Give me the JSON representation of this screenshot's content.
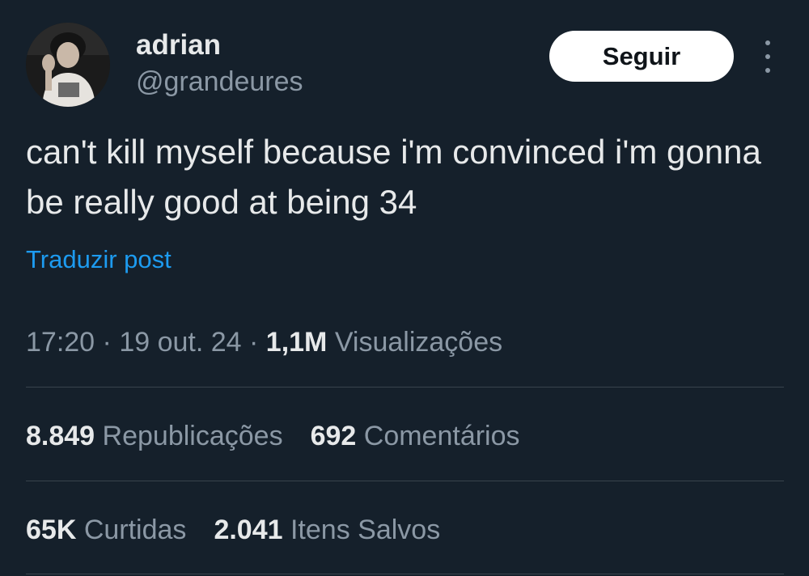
{
  "author": {
    "display_name": "adrian",
    "handle": "@grandeures",
    "avatar_icon": "profile-photo"
  },
  "actions": {
    "follow_label": "Seguir",
    "more_icon": "more-options-icon"
  },
  "tweet": {
    "text": "can't kill myself because i'm convinced i'm gonna be really good at being 34",
    "translate_label": "Traduzir post"
  },
  "meta": {
    "time": "17:20",
    "separator": " · ",
    "date": "19 out. 24",
    "views_count": "1,1M",
    "views_label": "Visualizações"
  },
  "stats": {
    "reposts_count": "8.849",
    "reposts_label": "Republicações",
    "comments_count": "692",
    "comments_label": "Comentários",
    "likes_count": "65K",
    "likes_label": "Curtidas",
    "bookmarks_count": "2.041",
    "bookmarks_label": "Itens Salvos"
  },
  "colors": {
    "background": "#15202b",
    "text_primary": "#e7e9ea",
    "text_secondary": "#8b98a5",
    "link": "#1d9bf0",
    "divider": "#38444d",
    "follow_button_bg": "#ffffff"
  }
}
